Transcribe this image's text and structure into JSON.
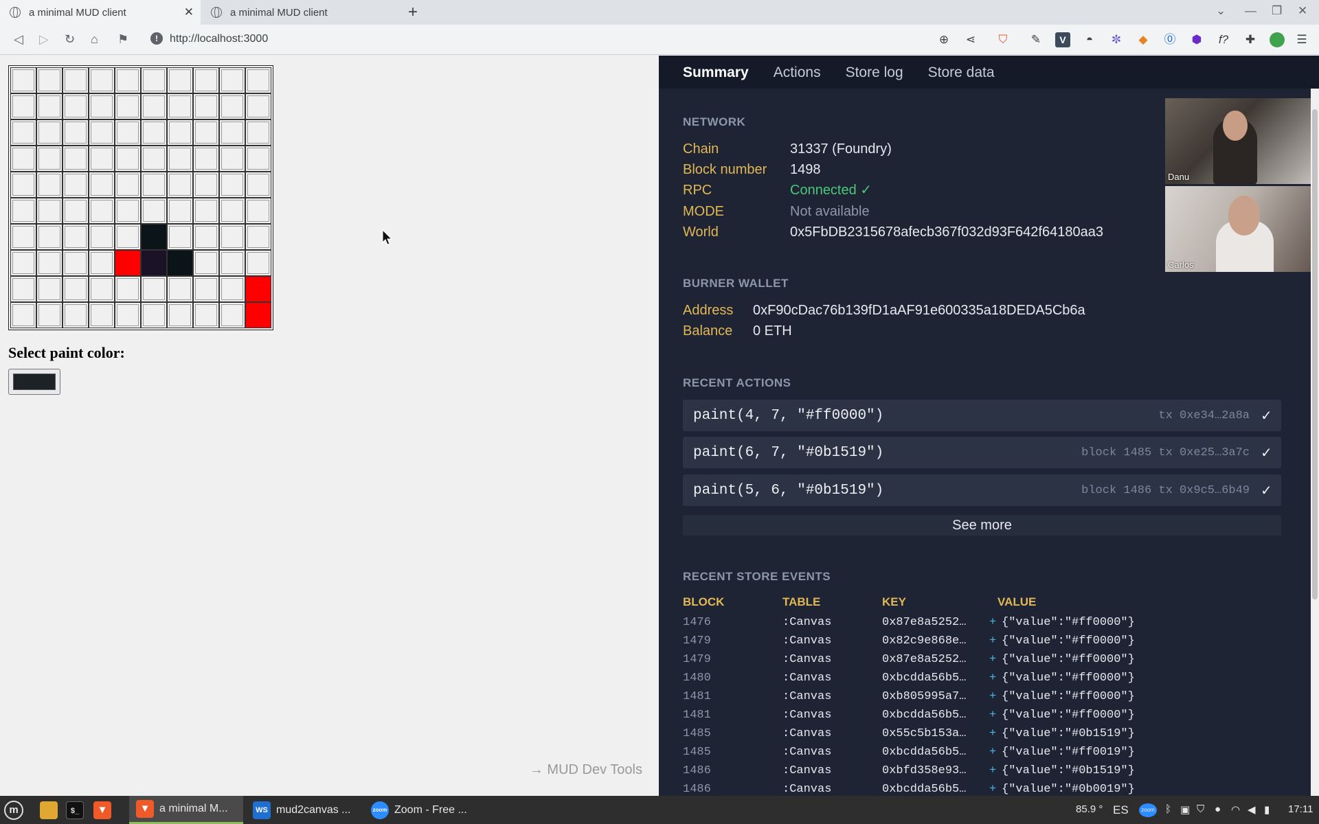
{
  "browser": {
    "tabs": [
      {
        "title": "a minimal MUD client",
        "active": true
      },
      {
        "title": "a minimal MUD client",
        "active": false
      }
    ],
    "url": "http://localhost:3000"
  },
  "app": {
    "canvas": {
      "rows": 10,
      "cols": 10,
      "painted": [
        {
          "x": 5,
          "y": 6,
          "color": "#0b1519"
        },
        {
          "x": 4,
          "y": 7,
          "color": "#ff0000"
        },
        {
          "x": 5,
          "y": 7,
          "color": "#1b1228"
        },
        {
          "x": 6,
          "y": 7,
          "color": "#0b1519"
        },
        {
          "x": 9,
          "y": 8,
          "color": "#ff0000"
        },
        {
          "x": 9,
          "y": 9,
          "color": "#ff0000"
        }
      ]
    },
    "color_label": "Select paint color:",
    "selected_color": "#1c2226",
    "devtools_link": "→ MUD Dev Tools"
  },
  "devtools": {
    "tabs": [
      "Summary",
      "Actions",
      "Store log",
      "Store data"
    ],
    "network": {
      "heading": "NETWORK",
      "chain_label": "Chain",
      "chain_value": "31337 (Foundry)",
      "block_label": "Block number",
      "block_value": "1498",
      "rpc_label": "RPC",
      "rpc_value": "Connected ✓",
      "mode_label": "MODE",
      "mode_value": "Not available",
      "world_label": "World",
      "world_value": "0x5FbDB2315678afecb367f032d93F642f64180aa3"
    },
    "wallet": {
      "heading": "BURNER WALLET",
      "address_label": "Address",
      "address_value": "0xF90cDac76b139fD1aAF91e600335a18DEDA5Cb6a",
      "balance_label": "Balance",
      "balance_value": "0 ETH"
    },
    "recent_actions": {
      "heading": "RECENT ACTIONS",
      "items": [
        {
          "call": "paint(4, 7, \"#ff0000\")",
          "meta": "tx 0xe34…2a8a",
          "status": "✓"
        },
        {
          "call": "paint(6, 7, \"#0b1519\")",
          "meta": "block 1485 tx 0xe25…3a7c",
          "status": "✓"
        },
        {
          "call": "paint(5, 6, \"#0b1519\")",
          "meta": "block 1486 tx 0x9c5…6b49",
          "status": "✓"
        }
      ],
      "see_more": "See more"
    },
    "store_events": {
      "heading": "RECENT STORE EVENTS",
      "columns": [
        "BLOCK",
        "TABLE",
        "KEY",
        "VALUE"
      ],
      "rows": [
        {
          "block": "1476",
          "table": ":Canvas",
          "key": "0x87e8a5252…",
          "op": "+",
          "value": "{\"value\":\"#ff0000\"}"
        },
        {
          "block": "1479",
          "table": ":Canvas",
          "key": "0x82c9e868e…",
          "op": "+",
          "value": "{\"value\":\"#ff0000\"}"
        },
        {
          "block": "1479",
          "table": ":Canvas",
          "key": "0x87e8a5252…",
          "op": "+",
          "value": "{\"value\":\"#ff0000\"}"
        },
        {
          "block": "1480",
          "table": ":Canvas",
          "key": "0xbcdda56b5…",
          "op": "+",
          "value": "{\"value\":\"#ff0000\"}"
        },
        {
          "block": "1481",
          "table": ":Canvas",
          "key": "0xb805995a7…",
          "op": "+",
          "value": "{\"value\":\"#ff0000\"}"
        },
        {
          "block": "1481",
          "table": ":Canvas",
          "key": "0xbcdda56b5…",
          "op": "+",
          "value": "{\"value\":\"#ff0000\"}"
        },
        {
          "block": "1485",
          "table": ":Canvas",
          "key": "0x55c5b153a…",
          "op": "+",
          "value": "{\"value\":\"#0b1519\"}"
        },
        {
          "block": "1485",
          "table": ":Canvas",
          "key": "0xbcdda56b5…",
          "op": "+",
          "value": "{\"value\":\"#ff0019\"}"
        },
        {
          "block": "1486",
          "table": ":Canvas",
          "key": "0xbfd358e93…",
          "op": "+",
          "value": "{\"value\":\"#0b1519\"}"
        },
        {
          "block": "1486",
          "table": ":Canvas",
          "key": "0xbcdda56b5…",
          "op": "+",
          "value": "{\"value\":\"#0b0019\"}"
        }
      ]
    },
    "video_participants": [
      "Danu",
      "Carlos"
    ]
  },
  "taskbar": {
    "apps": [
      "a minimal M...",
      "mud2canvas ...",
      "Zoom - Free ..."
    ],
    "temperature": "85.9 °",
    "keyboard_layout": "ES",
    "clock": "17:11",
    "app_icon_labels": [
      "WS",
      "zoom"
    ]
  }
}
